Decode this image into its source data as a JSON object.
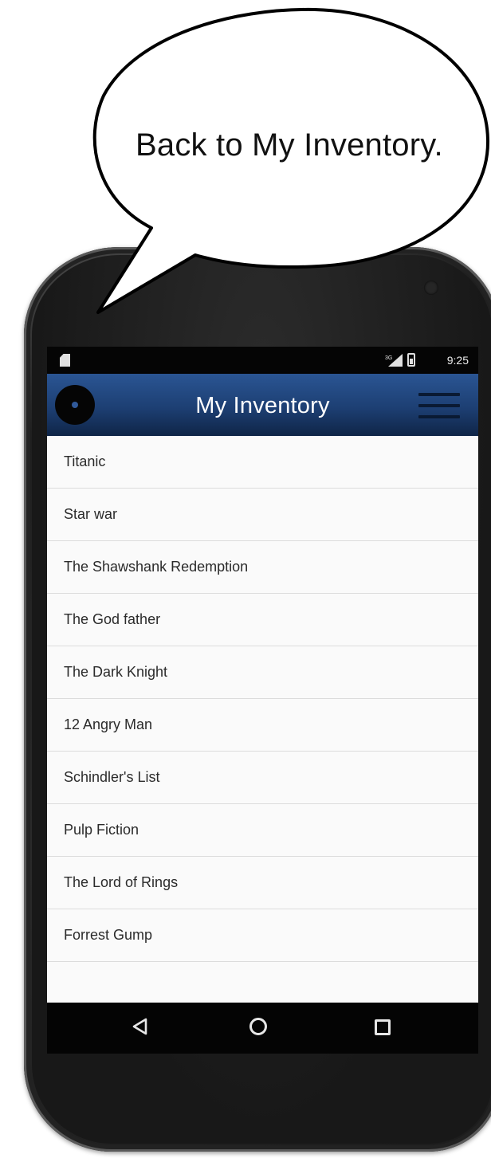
{
  "callout": {
    "text": "Back to My Inventory."
  },
  "status_bar": {
    "network": "3G",
    "time": "9:25"
  },
  "app_bar": {
    "title": "My Inventory",
    "logo_icon": "disc-icon",
    "menu_icon": "hamburger-menu-icon"
  },
  "inventory": {
    "items": [
      {
        "label": "Titanic"
      },
      {
        "label": "Star war"
      },
      {
        "label": "The Shawshank Redemption"
      },
      {
        "label": "The God father"
      },
      {
        "label": "The Dark Knight"
      },
      {
        "label": "12 Angry Man"
      },
      {
        "label": "Schindler's List"
      },
      {
        "label": "Pulp Fiction"
      },
      {
        "label": "The Lord of Rings"
      },
      {
        "label": "Forrest Gump"
      }
    ]
  },
  "nav_bar": {
    "back_icon": "back-triangle-icon",
    "home_icon": "home-circle-icon",
    "recents_icon": "recents-square-icon"
  },
  "colors": {
    "app_bar_top": "#2a5593",
    "app_bar_bottom": "#0f2547",
    "list_background": "#fafafa",
    "divider": "#dcdcdc",
    "status_bar": "#050505"
  }
}
